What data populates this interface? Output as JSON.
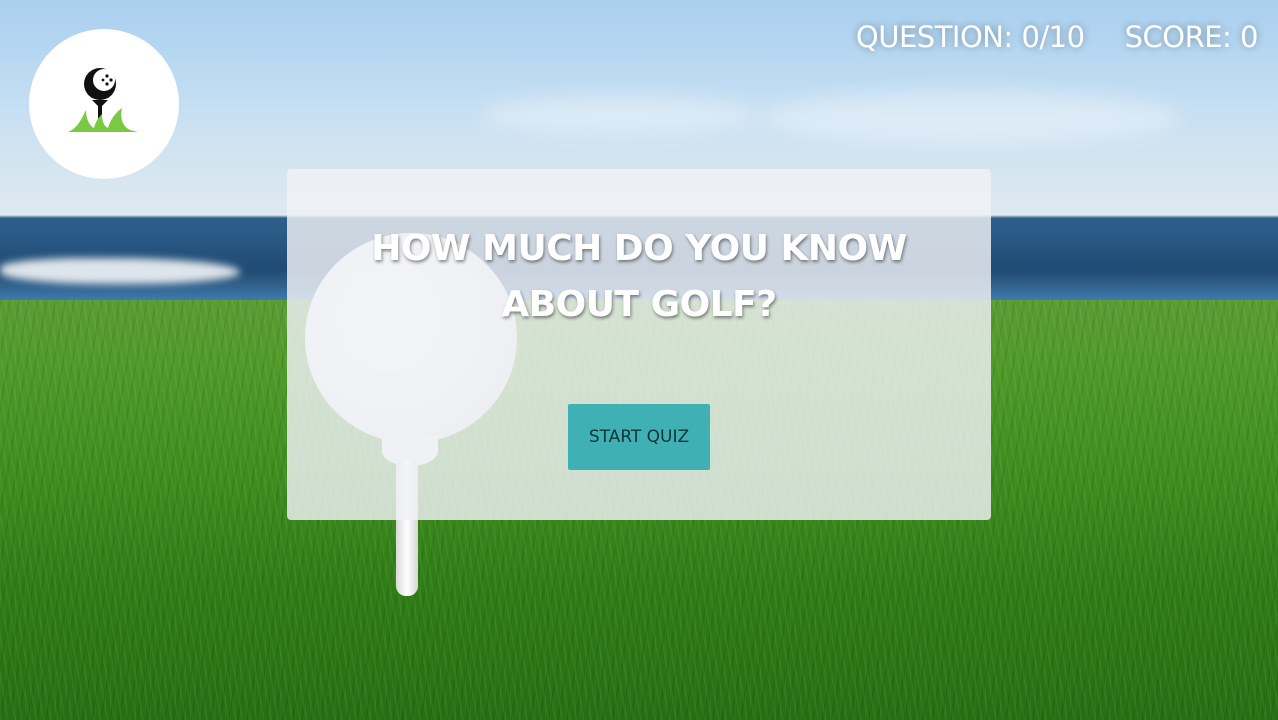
{
  "hud": {
    "question_text": "QUESTION: 0/10",
    "score_text": "SCORE: 0"
  },
  "logo": {
    "icon": "golf-ball-on-tee-icon"
  },
  "quiz": {
    "title": "HOW MUCH DO YOU KNOW ABOUT GOLF?",
    "start_label": "START QUIZ",
    "accent_color": "#3fb1b5"
  }
}
